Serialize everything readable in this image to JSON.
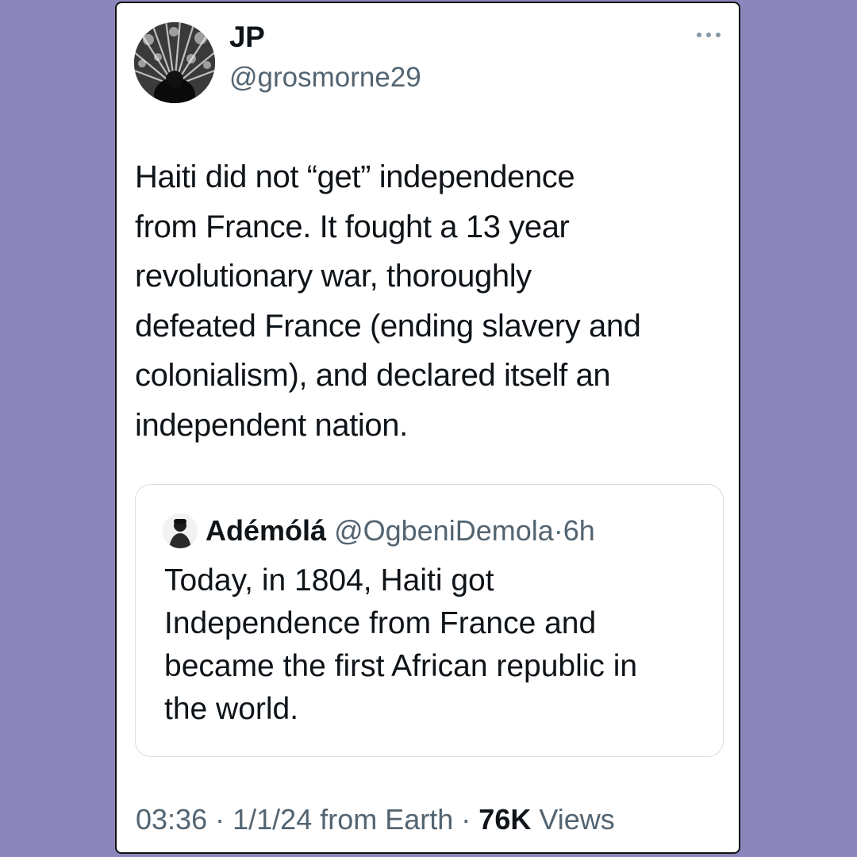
{
  "tweet": {
    "author": {
      "display_name": "JP",
      "handle": "@grosmorne29"
    },
    "more_icon": "more-horizontal-icon",
    "text": "Haiti did not “get” independence\nfrom France. It fought a 13 year\nrevolutionary war, thoroughly\ndefeated France (ending slavery and\ncolonialism), and declared itself an\nindependent nation.",
    "quote": {
      "display_name": "Adémólá",
      "handle": "@OgbeniDemola",
      "separator": "·",
      "time_ago": "6h",
      "text": "Today, in 1804, Haiti got\nIndependence from France and\nbecame the first African republic in\nthe world."
    },
    "footer": {
      "time": "03:36",
      "date_location": "1/1/24 from Earth",
      "separator": "·",
      "views_count": "76K",
      "views_label": "Views"
    }
  },
  "colors": {
    "background": "#8b87bd",
    "card": "#ffffff",
    "text_primary": "#0f1419",
    "text_secondary": "#536471",
    "quote_border": "#d7dde2"
  }
}
